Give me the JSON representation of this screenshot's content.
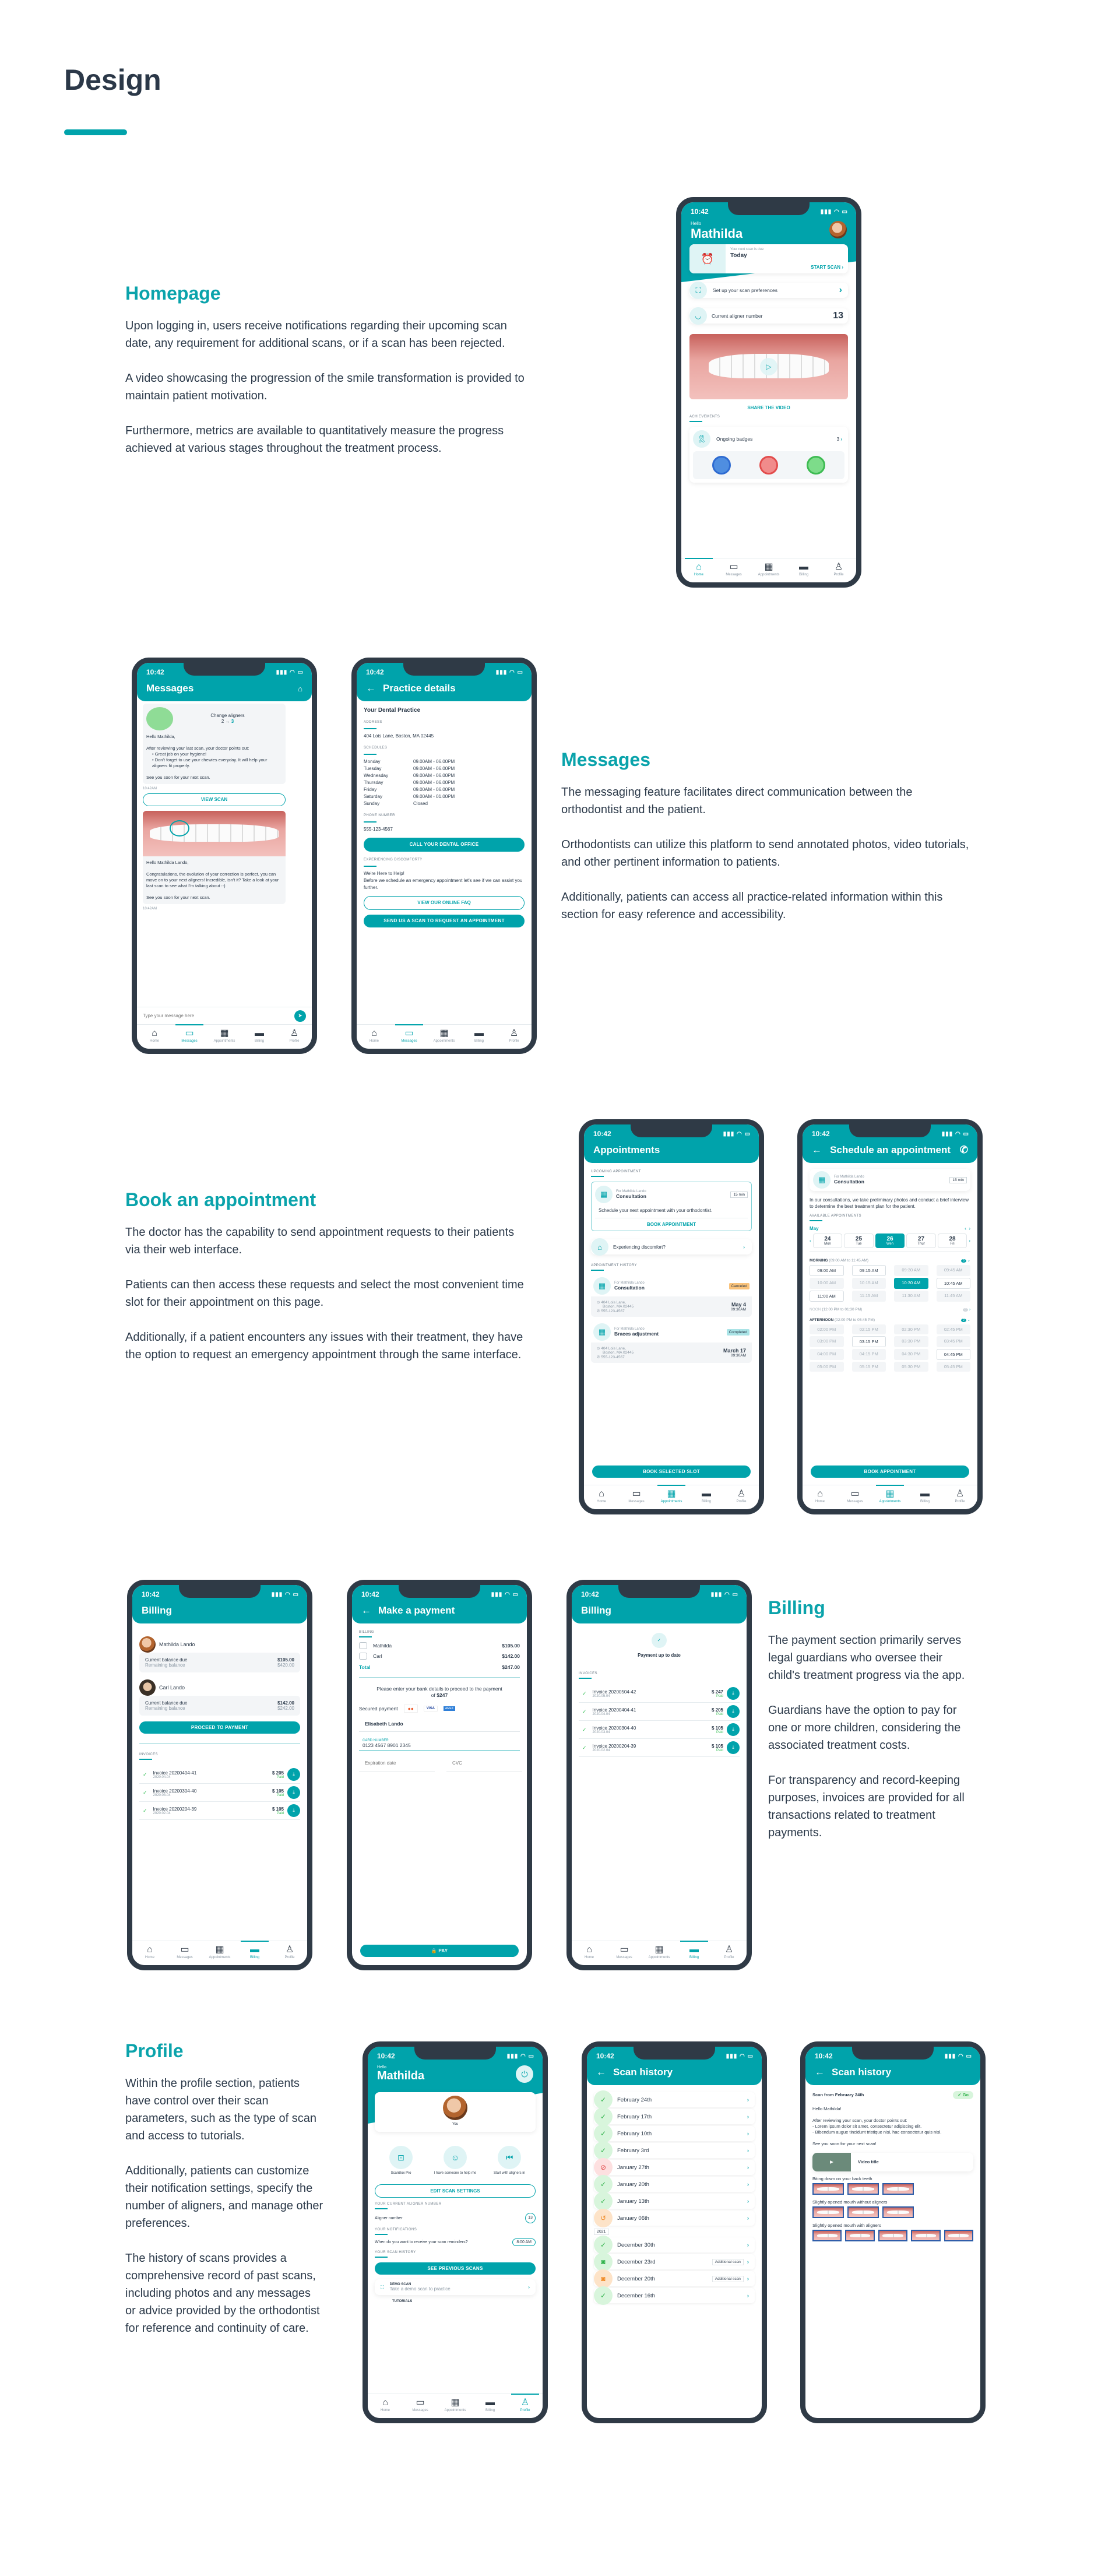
{
  "page": {
    "title": "Design",
    "accent": "#00a3ab"
  },
  "sections": {
    "homepage": {
      "heading": "Homepage",
      "paragraphs": [
        "Upon logging in, users receive notifications regarding their upcoming scan date, any requirement for additional scans, or if a scan has been rejected.",
        "A video showcasing the progression of the smile transformation is provided to maintain patient motivation.",
        "Furthermore, metrics are available to quantitatively measure the progress achieved at various stages throughout the treatment process."
      ]
    },
    "messages": {
      "heading": "Messages",
      "paragraphs": [
        "The messaging feature facilitates direct communication between the orthodontist and the patient.",
        "Orthodontists can utilize this platform to send annotated photos, video tutorials, and other pertinent information to patients.",
        "Additionally, patients can access all practice-related information within this section for easy reference and accessibility."
      ]
    },
    "appointment": {
      "heading": "Book an appointment",
      "paragraphs": [
        "The doctor has the capability to send appointment requests to their patients via their web interface.",
        "Patients can then access these requests and select the most convenient time slot for their appointment on this page.",
        "Additionally, if a patient encounters any issues with their treatment, they have the option to request an emergency appointment through the same interface."
      ]
    },
    "billing": {
      "heading": "Billing",
      "paragraphs": [
        "The payment section primarily serves legal guardians who oversee their child's treatment progress via the app.",
        "Guardians have the option to pay for one or more children, considering the associated treatment costs.",
        "For transparency and record-keeping purposes, invoices are provided for all transactions related to treatment payments."
      ]
    },
    "profile": {
      "heading": "Profile",
      "paragraphs": [
        "Within the profile section, patients have control over their scan parameters, such as the type of scan and access to tutorials.",
        "Additionally, patients can customize their notification settings, specify the number of aligners, and manage other preferences.",
        "The history of scans provides a comprehensive record of past scans, including photos and any messages or advice provided by the orthodontist for reference and continuity of care."
      ]
    }
  },
  "common": {
    "time": "10:42",
    "tabs": [
      "Home",
      "Messages",
      "Appointments",
      "Billing",
      "Profile"
    ]
  },
  "home_screen": {
    "greeting": "Hello",
    "name": "Mathilda",
    "scan_due_label": "Your next scan is due",
    "scan_due_value": "Today",
    "start_scan": "START SCAN",
    "scan_prefs": "Set up your scan preferences",
    "aligner_label": "Current aligner number",
    "aligner_value": "13",
    "share_video": "SHARE THE VIDEO",
    "achievements_label": "ACHIEVEMENTS",
    "badges_label": "Ongoing badges",
    "badges_count": "3"
  },
  "messages_screen": {
    "title": "Messages",
    "card_title": "Change aligners",
    "from": "2",
    "to": "3",
    "msg1": [
      "Hello Mathilda,",
      "After reviewing your last scan, your doctor points out:",
      "Great job on your hygiene!",
      "Don't forget to use your chewies everyday. It will help your aligners fit properly.",
      "See you soon for your next scan."
    ],
    "msg1_time": "10:42AM",
    "view_scan": "VIEW  SCAN",
    "msg2": [
      "Hello Mathilda Lando,",
      "Congratulations, the evolution of your correction is perfect, you can move on to your next aligners! Incredible, isn't it? Take a look at your last scan to see what I'm talking about :-)",
      "See you soon for your next scan."
    ],
    "msg2_time": "10:42AM",
    "input_placeholder": "Type your message here"
  },
  "practice_screen": {
    "title": "Practice details",
    "heading": "Your Dental Practice",
    "address_label": "ADDRESS",
    "address": "404 Lois Lane, Boston, MA 02445",
    "schedules_label": "SCHEDULES",
    "schedules": [
      {
        "day": "Monday",
        "hours": "09.00AM - 06.00PM"
      },
      {
        "day": "Tuesday",
        "hours": "09.00AM - 06.00PM"
      },
      {
        "day": "Wednesday",
        "hours": "09.00AM - 06.00PM"
      },
      {
        "day": "Thursday",
        "hours": "09.00AM - 06.00PM"
      },
      {
        "day": "Friday",
        "hours": "09.00AM - 06.00PM"
      },
      {
        "day": "Saturday",
        "hours": "09.00AM - 01.00PM"
      },
      {
        "day": "Sunday",
        "hours": "Closed"
      }
    ],
    "phone_label": "PHONE NUMBER",
    "phone": "555-123-4567",
    "call_btn": "CALL YOUR DENTAL OFFICE",
    "discomfort_label": "EXPERIENCING DISCOMFORT?",
    "help_title": "We're Here to Help!",
    "help_text": "Before we schedule an emergency appointment let's see if we can assist you further.",
    "faq_btn": "VIEW OUR ONLINE FAQ",
    "scan_btn": "SEND US A SCAN TO REQUEST AN APPOINTMENT"
  },
  "appointments_screen": {
    "title": "Appointments",
    "upcoming_label": "UPCOMING APPOINTMENT",
    "for": "For Mathilda Lando",
    "type": "Consultation",
    "duration": "15 min",
    "upcoming_text": "Schedule your next appointment with your orthodontist.",
    "book_link": "BOOK APPOINTMENT",
    "discomfort": "Experiencing discomfort?",
    "history_label": "APPOINTMENT HISTORY",
    "history": [
      {
        "for": "For Mathilda Lando",
        "type": "Consultation",
        "status": "Canceled",
        "status_color": "#f9c27a",
        "address1": "404 Lois Lane,",
        "address2": "Boston, MA 02445",
        "phone": "555-123-4567",
        "date": "May 4",
        "time": "09:30AM"
      },
      {
        "for": "For Mathilda Lando",
        "type": "Braces adjustment",
        "status": "Completed",
        "status_color": "#a9e3e6",
        "address1": "404 Lois Lane,",
        "address2": "Boston, MA 02445",
        "phone": "555-123-4567",
        "date": "March 17",
        "time": "09:30AM"
      }
    ],
    "book_slot_btn": "BOOK SELECTED SLOT"
  },
  "schedule_screen": {
    "title": "Schedule an appointment",
    "for": "For Mathilda Lando",
    "type": "Consultation",
    "duration": "15 min",
    "description": "In our consultations, we take preliminary photos and conduct a brief interview to determine the best treatment plan for the patient.",
    "available_label": "AVAILABLE APPOINTMENTS",
    "month": "May",
    "days": [
      {
        "num": "24",
        "name": "Mon"
      },
      {
        "num": "25",
        "name": "Tue"
      },
      {
        "num": "26",
        "name": "Wen",
        "selected": true
      },
      {
        "num": "27",
        "name": "Thur"
      },
      {
        "num": "28",
        "name": "Fri"
      }
    ],
    "morning": {
      "label": "MORNING",
      "range": "(09:00 AM to 11:45 AM)",
      "count": "5",
      "slots": [
        {
          "t": "09:00 AM",
          "s": "av"
        },
        {
          "t": "09:15 AM",
          "s": "av"
        },
        {
          "t": "09:30 AM",
          "s": "na"
        },
        {
          "t": "09:45 AM",
          "s": "na"
        },
        {
          "t": "10:00 AM",
          "s": "na"
        },
        {
          "t": "10:15 AM",
          "s": "na"
        },
        {
          "t": "10:30 AM",
          "s": "sel"
        },
        {
          "t": "10:45 AM",
          "s": "av"
        },
        {
          "t": "11:00 AM",
          "s": "av"
        },
        {
          "t": "11:15 AM",
          "s": "na"
        },
        {
          "t": "11:30 AM",
          "s": "na"
        },
        {
          "t": "11:45 AM",
          "s": "na"
        }
      ]
    },
    "noon": {
      "label": "NOON",
      "range": "(12:00 PM to 01:30 PM)",
      "count": "0"
    },
    "afternoon": {
      "label": "AFTERNOON",
      "range": "(02:00 PM to 05:45 PM)",
      "count": "2",
      "slots": [
        {
          "t": "02:00 PM",
          "s": "na"
        },
        {
          "t": "02:15 PM",
          "s": "na"
        },
        {
          "t": "02:30 PM",
          "s": "na"
        },
        {
          "t": "02:45 PM",
          "s": "na"
        },
        {
          "t": "03:00 PM",
          "s": "na"
        },
        {
          "t": "03:15 PM",
          "s": "av"
        },
        {
          "t": "03:30 PM",
          "s": "na"
        },
        {
          "t": "03:45 PM",
          "s": "na"
        },
        {
          "t": "04:00 PM",
          "s": "na"
        },
        {
          "t": "04:15 PM",
          "s": "na"
        },
        {
          "t": "04:30 PM",
          "s": "na"
        },
        {
          "t": "04:45 PM",
          "s": "av"
        },
        {
          "t": "05:00 PM",
          "s": "na"
        },
        {
          "t": "05:15 PM",
          "s": "na"
        },
        {
          "t": "05:30 PM",
          "s": "na"
        },
        {
          "t": "05:45 PM",
          "s": "na"
        }
      ]
    },
    "book_btn": "BOOK APPOINTMENT"
  },
  "billing_screen": {
    "title": "Billing",
    "patients": [
      {
        "name": "Mathilda Lando",
        "due_label": "Current balance due",
        "due": "$105.00",
        "remaining_label": "Remaining balance",
        "remaining": "$420.00"
      },
      {
        "name": "Carl Lando",
        "due_label": "Current balance due",
        "due": "$142.00",
        "remaining_label": "Remaining balance",
        "remaining": "$242.00"
      }
    ],
    "proceed_btn": "PROCEED TO PAYMENT",
    "invoices_label": "INVOICES",
    "invoices": [
      {
        "name": "Invoice 20200404-41",
        "date": "2020.04.04",
        "amount": "$ 205",
        "status": "Paid"
      },
      {
        "name": "Invoice 20200304-40",
        "date": "2020.03.04",
        "amount": "$ 105",
        "status": "Paid"
      },
      {
        "name": "Invoice 20200204-39",
        "date": "2020.02.04",
        "amount": "$ 105",
        "status": "Paid"
      }
    ]
  },
  "payment_screen": {
    "title": "Make a payment",
    "billing_label": "BILLING",
    "items": [
      {
        "name": "Mathilda",
        "amount": "$105.00"
      },
      {
        "name": "Carl",
        "amount": "$142.00"
      }
    ],
    "total_label": "Total",
    "total": "$247.00",
    "instructions": "Please enter your bank details to proceed to the payment of",
    "instructions_amount": "$247",
    "secured": "Secured payment",
    "cards": [
      "mastercard",
      "VISA",
      "AMEX"
    ],
    "holder": "Elisabeth Lando",
    "card_label": "CARD NUMBER",
    "card_number": "0123 4567 8901 2345",
    "exp_placeholder": "Expiration date",
    "cvc_placeholder": "CVC",
    "pay_btn": "PAY"
  },
  "billing_paid_screen": {
    "title": "Billing",
    "status": "Payment up to date",
    "invoices_label": "INVOICES",
    "invoices": [
      {
        "name": "Invoice 20200504-42",
        "date": "2020.05.04",
        "amount": "$ 247",
        "status": "Paid"
      },
      {
        "name": "Invoice 20200404-41",
        "date": "2020.04.04",
        "amount": "$ 205",
        "status": "Paid"
      },
      {
        "name": "Invoice 20200304-40",
        "date": "2020.03.04",
        "amount": "$ 105",
        "status": "Paid"
      },
      {
        "name": "Invoice 20200204-39",
        "date": "2020.02.04",
        "amount": "$ 105",
        "status": "Paid"
      }
    ]
  },
  "profile_screen": {
    "greeting": "Hello",
    "name": "Mathilda",
    "you": "You",
    "options": [
      "ScanBox Pro",
      "I have someone to help me",
      "Start with aligners in"
    ],
    "edit_btn": "EDIT SCAN SETTINGS",
    "aligner_section": "YOUR CURRENT ALIGNER NUMBER",
    "aligner_label": "Aligner number",
    "aligner_value": "13",
    "notif_section": "YOUR NOTIFICATIONS",
    "notif_question": "When do you want to receive your scan reminders?",
    "notif_time": "8:00 AM",
    "history_section": "YOUR SCAN HISTORY",
    "history_btn": "SEE PREVIOUS SCANS",
    "demo_title": "DEMO SCAN",
    "demo_sub": "Take a demo scan to practice",
    "tutorials": "TUTORIALS"
  },
  "scan_history_screen": {
    "title": "Scan history",
    "year_divider": "2021",
    "items": [
      {
        "date": "February 24th",
        "status": "ok"
      },
      {
        "date": "February 17th",
        "status": "ok"
      },
      {
        "date": "February 10th",
        "status": "ok"
      },
      {
        "date": "February 3rd",
        "status": "ok"
      },
      {
        "date": "January 27th",
        "status": "rejected"
      },
      {
        "date": "January 20th",
        "status": "ok"
      },
      {
        "date": "January 13th",
        "status": "ok"
      },
      {
        "date": "January 06th",
        "status": "retry"
      },
      {
        "date": "December 30th",
        "status": "ok"
      },
      {
        "date": "December 23rd",
        "status": "additional-ok",
        "tag": "Additional scan"
      },
      {
        "date": "December 20th",
        "status": "additional-fail",
        "tag": "Additional scan"
      },
      {
        "date": "December 16th",
        "status": "ok"
      }
    ]
  },
  "scan_detail_screen": {
    "title": "Scan history",
    "scan_title": "Scan from February 24th",
    "go": "Go",
    "greeting": "Hello Mathilda!",
    "intro": "After reviewing your scan, your doctor points out:",
    "points": [
      "- Lorem ipsum dolor sit amet, consectetur adipiscing elit.",
      "- Bibendum augue tincidunt tristique nisi, hac consectetur quis nisl."
    ],
    "outro": "See you soon for your next scan!",
    "video_title": "Video title",
    "groups": [
      {
        "label": "Biting down on your back teeth",
        "count": 3
      },
      {
        "label": "Slightly opened mouth without aligners",
        "count": 3
      },
      {
        "label": "Slightly opened mouth with aligners",
        "count": 5
      }
    ]
  }
}
